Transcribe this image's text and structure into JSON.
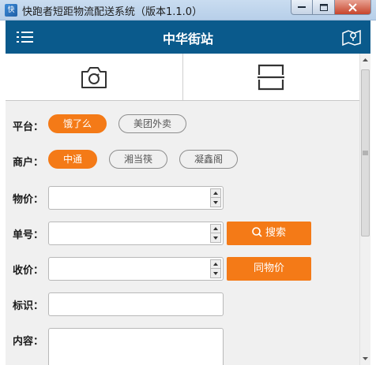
{
  "window": {
    "title": "快跑者短距物流配送系统（版本1.1.0）",
    "app_icon_text": "快"
  },
  "header": {
    "title": "中华街站",
    "brand_color": "#0a5a8c",
    "icons": [
      "menu-icon",
      "map-icon"
    ]
  },
  "toolbar": {
    "items": [
      {
        "icon": "camera-icon"
      },
      {
        "icon": "scan-icon"
      }
    ]
  },
  "form": {
    "platform": {
      "label": "平台：",
      "options": [
        {
          "label": "饿了么",
          "selected": true
        },
        {
          "label": "美团外卖",
          "selected": false
        }
      ]
    },
    "merchant": {
      "label": "商户：",
      "options": [
        {
          "label": "中通",
          "selected": true
        },
        {
          "label": "湘当筷",
          "selected": false
        },
        {
          "label": "凝鑫阁",
          "selected": false
        }
      ]
    },
    "item_price": {
      "label": "物价：",
      "value": ""
    },
    "order_no": {
      "label": "单号：",
      "value": "",
      "button": "搜索"
    },
    "collect_price": {
      "label": "收价：",
      "value": "",
      "button": "同物价"
    },
    "identifier": {
      "label": "标识：",
      "value": ""
    },
    "content": {
      "label": "内容：",
      "value": ""
    }
  },
  "accent_color": "#f47a17"
}
